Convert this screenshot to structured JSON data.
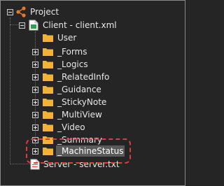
{
  "tree": {
    "root": {
      "label": "Project",
      "icon": "project-graph-icon",
      "expanded": true
    },
    "client": {
      "label": "Client - client.xml",
      "icon": "xml-file-icon",
      "expanded": true
    },
    "children": [
      {
        "label": "User",
        "icon": "folder-icon",
        "expandable": false
      },
      {
        "label": "_Forms",
        "icon": "folder-icon",
        "expandable": true
      },
      {
        "label": "_Logics",
        "icon": "folder-icon",
        "expandable": true
      },
      {
        "label": "_RelatedInfo",
        "icon": "folder-icon",
        "expandable": true
      },
      {
        "label": "_Guidance",
        "icon": "folder-icon",
        "expandable": true
      },
      {
        "label": "_StickyNote",
        "icon": "folder-icon",
        "expandable": true
      },
      {
        "label": "_MultiView",
        "icon": "folder-icon",
        "expandable": true
      },
      {
        "label": "_Video",
        "icon": "folder-icon",
        "expandable": true
      },
      {
        "label": "_Summary",
        "icon": "folder-icon",
        "expandable": true
      },
      {
        "label": "_MachineStatus",
        "icon": "folder-icon",
        "expandable": true,
        "selected": true
      }
    ],
    "server": {
      "label": "Server - server.txt",
      "icon": "text-file-icon"
    }
  },
  "colors": {
    "background": "#252526",
    "folder": "#f2b233",
    "selection": "#5a5a5a",
    "highlight_box": "#e23b3b",
    "root_icon": "#e8782a"
  }
}
